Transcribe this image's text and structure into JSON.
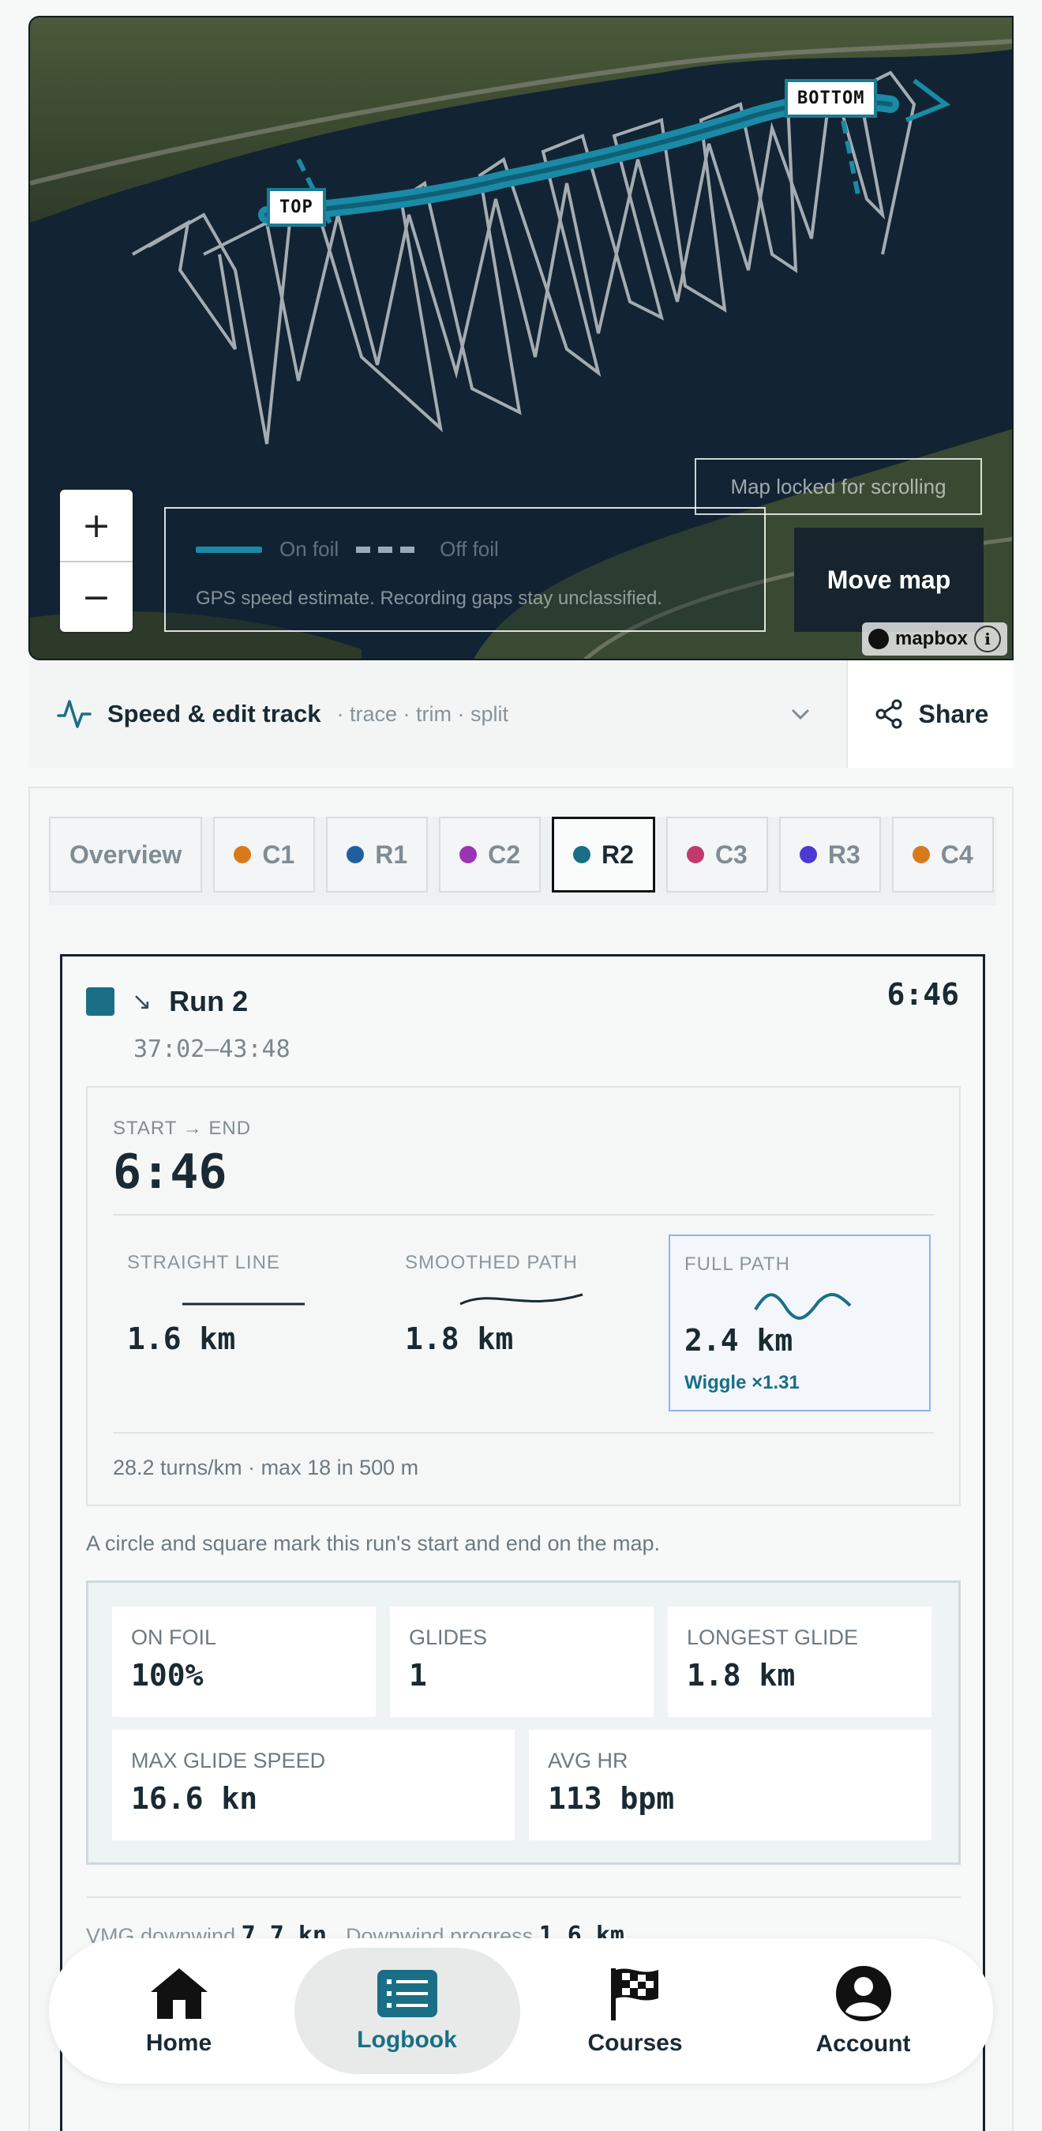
{
  "map": {
    "label_top": "TOP",
    "label_bottom": "BOTTOM",
    "legend_on": "On foil",
    "legend_off": "Off foil",
    "legend_note": "GPS speed estimate. Recording gaps stay unclassified.",
    "locked": "Map locked for scrolling",
    "move_button": "Move map",
    "zoom_in": "+",
    "zoom_out": "−",
    "attribution": "mapbox",
    "info": "i"
  },
  "toolbar": {
    "title": "Speed & edit track",
    "subtitle": "· trace · trim · split",
    "share": "Share"
  },
  "tabs": [
    {
      "label": "Overview",
      "color": ""
    },
    {
      "label": "C1",
      "color": "#d97a1a"
    },
    {
      "label": "R1",
      "color": "#1f5fa0"
    },
    {
      "label": "C2",
      "color": "#9b34b4"
    },
    {
      "label": "R2",
      "color": "#1a6f86"
    },
    {
      "label": "C3",
      "color": "#c13a6e"
    },
    {
      "label": "R3",
      "color": "#4a3ad0"
    },
    {
      "label": "C4",
      "color": "#d97a1a"
    }
  ],
  "run": {
    "title": "Run 2",
    "time": "6:46",
    "range": "37:02–43:48",
    "start_end_label": "START → END",
    "start_end_value": "6:46",
    "straight_label": "STRAIGHT LINE",
    "straight_value": "1.6 km",
    "smoothed_label": "SMOOTHED PATH",
    "smoothed_value": "1.8 km",
    "full_label": "FULL PATH",
    "full_value": "2.4 km",
    "wiggle": "Wiggle ×1.31",
    "turns": "28.2 turns/km · max 18 in 500 m",
    "circle_note": "A circle and square mark this run's start and end on the map.",
    "stats": {
      "on_foil_label": "ON FOIL",
      "on_foil": "100%",
      "glides_label": "GLIDES",
      "glides": "1",
      "longest_label": "LONGEST GLIDE",
      "longest": "1.8 km",
      "max_speed_label": "MAX GLIDE SPEED",
      "max_speed": "16.6 kn",
      "avg_hr_label": "AVG HR",
      "avg_hr": "113 bpm"
    },
    "vmg_label": "VMG downwind",
    "vmg": "7.7 kn",
    "progress_label": "Downwind progress",
    "progress": "1.6 km"
  },
  "nav": [
    {
      "label": "Home",
      "icon": "home-icon"
    },
    {
      "label": "Logbook",
      "icon": "logbook-icon"
    },
    {
      "label": "Courses",
      "icon": "flag-icon"
    },
    {
      "label": "Account",
      "icon": "account-icon"
    }
  ],
  "colors": {
    "accent": "#1a6f86",
    "track": "#1a8aa6",
    "water": "#102130"
  }
}
